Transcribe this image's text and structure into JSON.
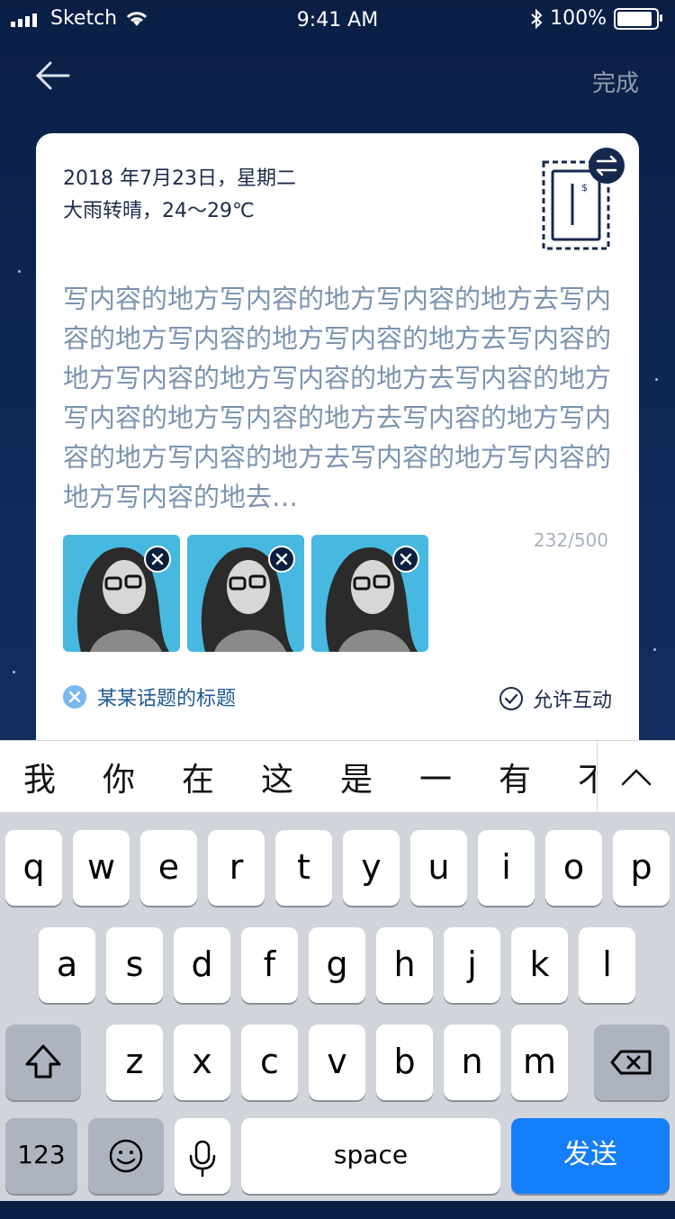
{
  "status_bar": {
    "carrier": "Sketch",
    "time": "9:41 AM",
    "battery": "100%",
    "battery_level": 1.0
  },
  "nav": {
    "done_label": "完成"
  },
  "card": {
    "date": "2018 年7月23日，星期二",
    "weather": "大雨转晴，24～29℃",
    "content": "写内容的地方写内容的地方写内容的地方去写内容的地方写内容的地方写内容的地方去写内容的地方写内容的地方写内容的地方去写内容的地方写内容的地方写内容的地方去写内容的地方写内容的地方写内容的地方去写内容的地方写内容的地方写内容的地去…",
    "counter": "232/500",
    "topic": "某某话题的标题",
    "allow_label": "允许互动"
  },
  "candidates": [
    "我",
    "你",
    "在",
    "这",
    "是",
    "一",
    "有",
    "不"
  ],
  "keyboard": {
    "row1": [
      "q",
      "w",
      "e",
      "r",
      "t",
      "y",
      "u",
      "i",
      "o",
      "p"
    ],
    "row2": [
      "a",
      "s",
      "d",
      "f",
      "g",
      "h",
      "j",
      "k",
      "l"
    ],
    "row3": [
      "z",
      "x",
      "c",
      "v",
      "b",
      "n",
      "m"
    ],
    "numbers_label": "123",
    "space_label": "space",
    "send_label": "发送"
  },
  "colors": {
    "background": "#0b1f45",
    "accent_blue": "#147efb",
    "topic_blue": "#1f5b96",
    "placeholder_text": "#7c93b0"
  },
  "icons": {
    "back": "arrow-left-icon",
    "stamp": "stamp-icon",
    "swap": "swap-icon",
    "remove_photo": "close-circle-icon",
    "topic_remove": "close-circle-icon",
    "allow_check": "check-circle-icon",
    "expand": "chevron-up-icon",
    "shift": "shift-icon",
    "backspace": "backspace-icon",
    "emoji": "emoji-icon",
    "mic": "microphone-icon"
  }
}
